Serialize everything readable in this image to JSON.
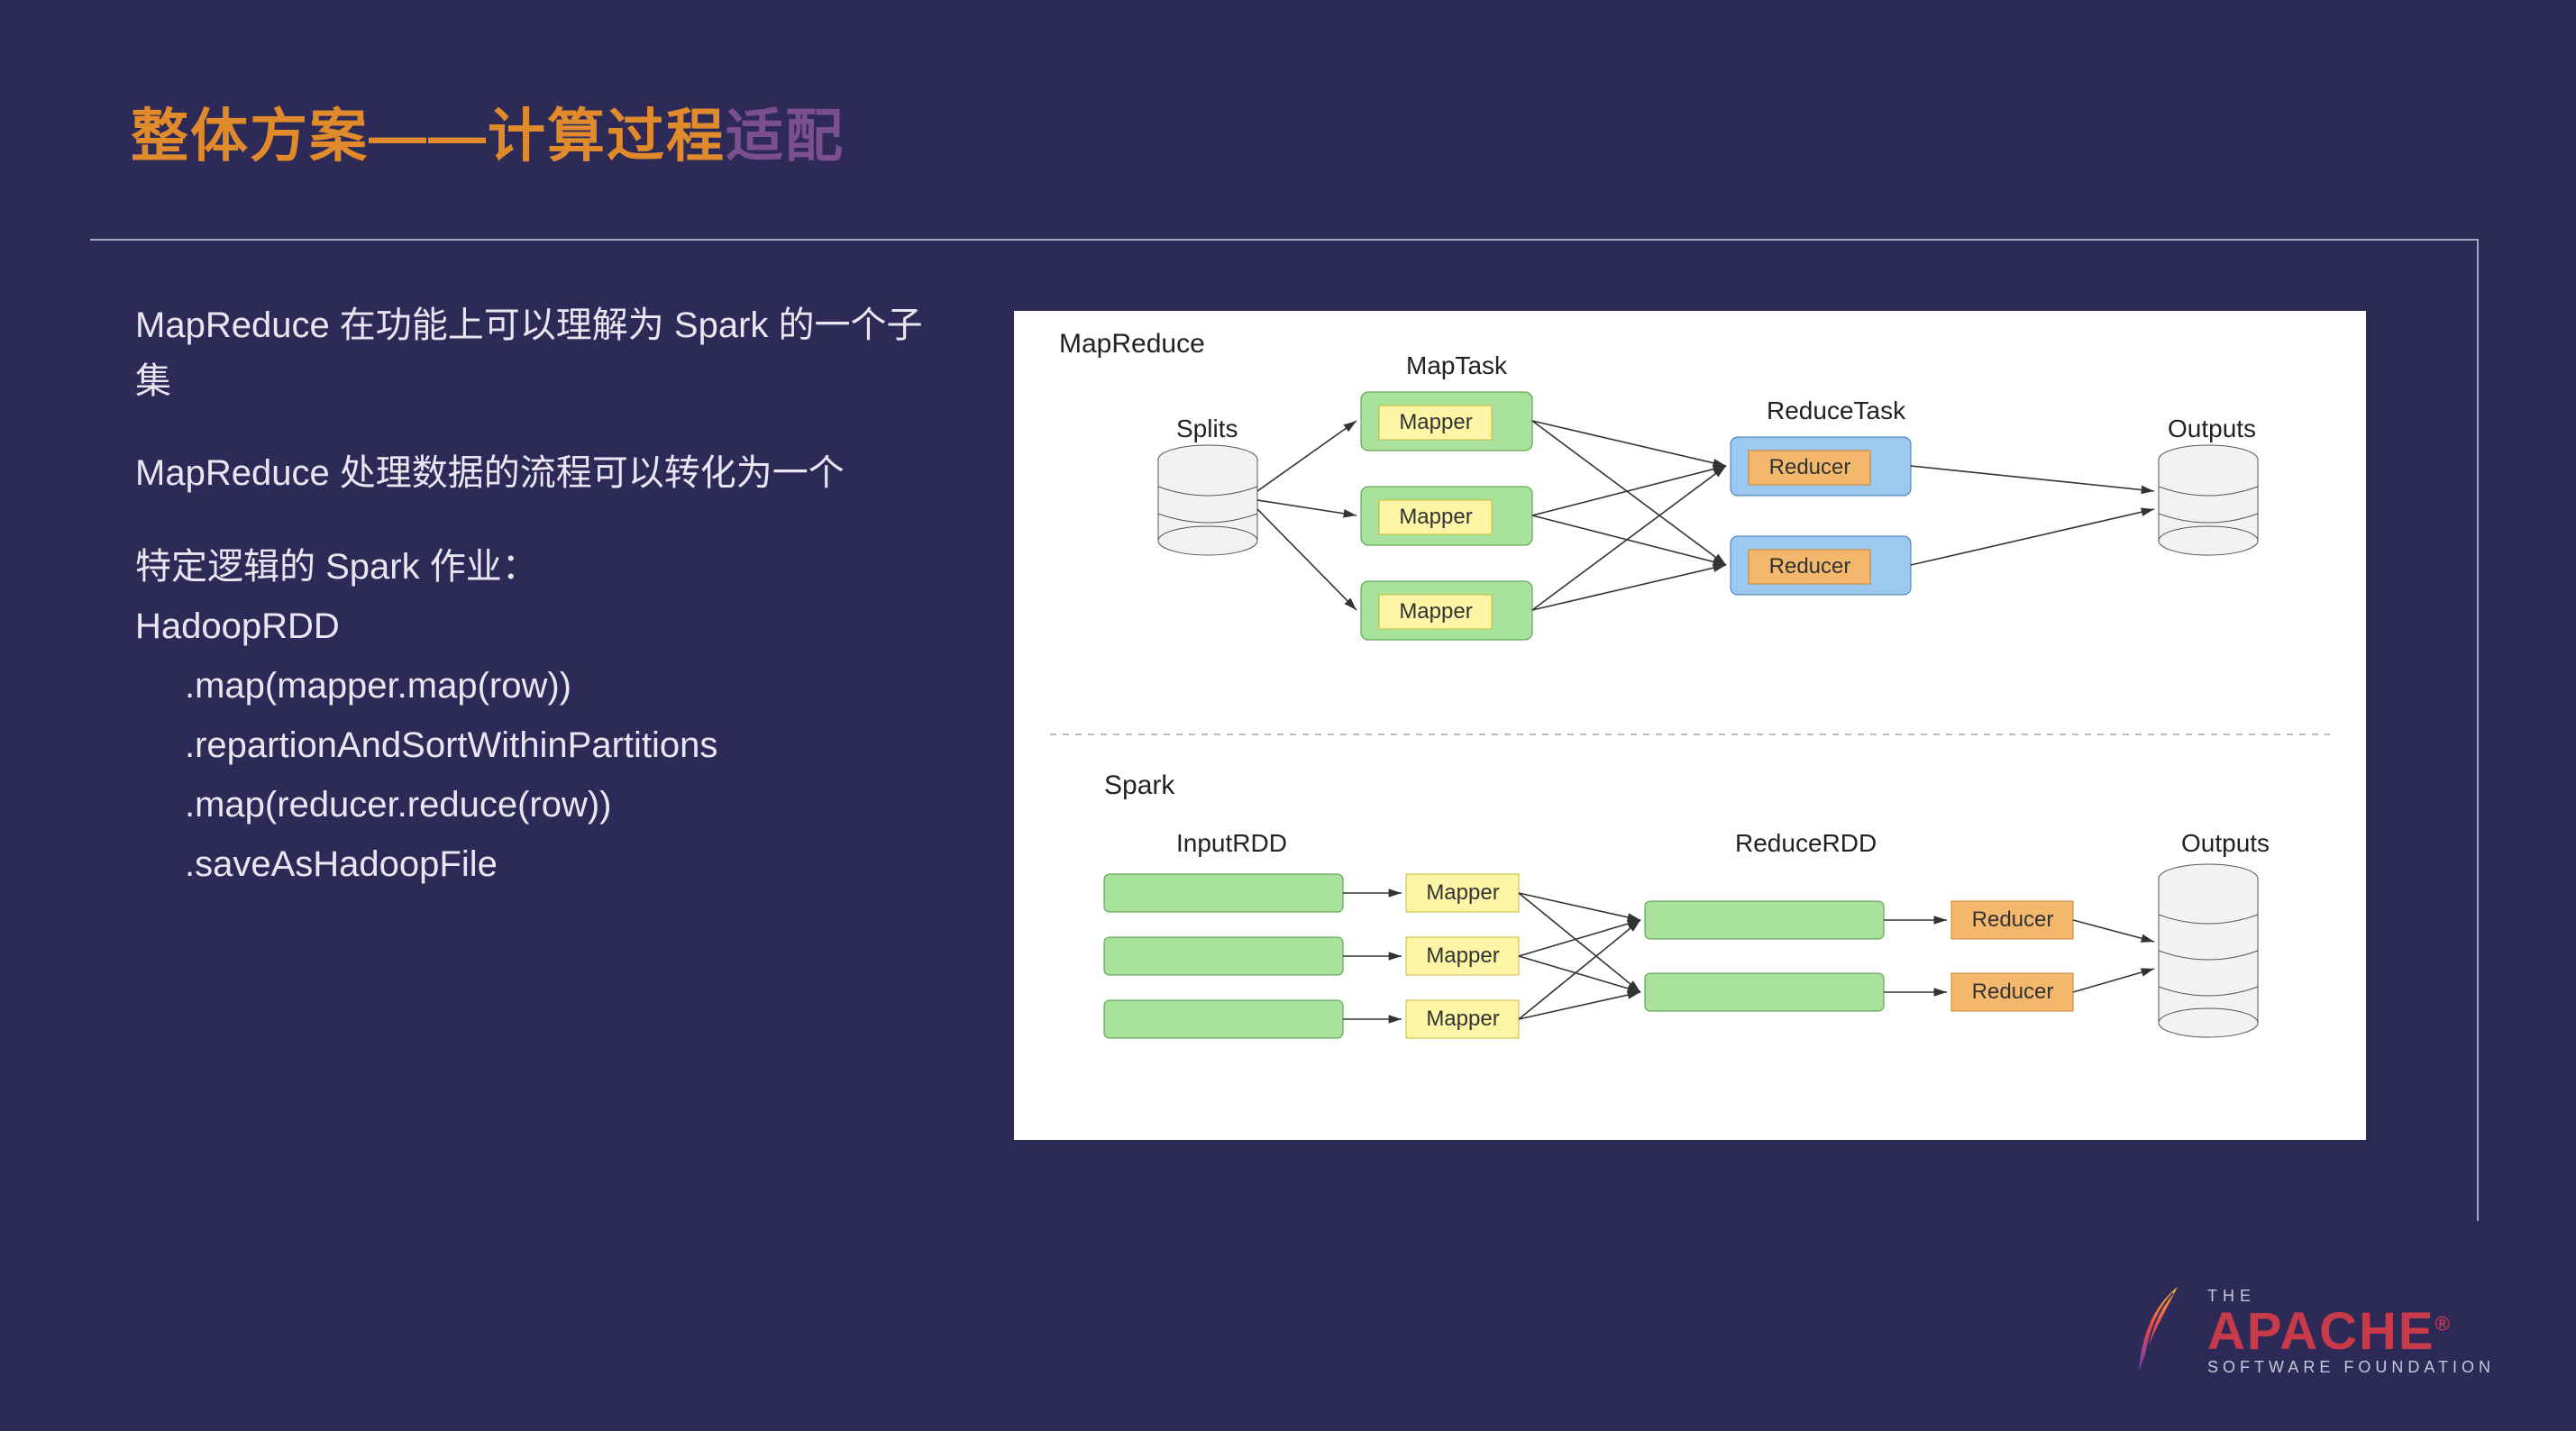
{
  "title": {
    "part1": "整体方案——计算",
    "part2": "过程",
    "part3": "适配"
  },
  "text": {
    "p1": "MapReduce 在功能上可以理解为 Spark 的一个子集",
    "p2": "MapReduce 处理数据的流程可以转化为一个",
    "p3": "特定逻辑的 Spark 作业：",
    "code": {
      "l1": "HadoopRDD",
      "l2": ".map(mapper.map(row))",
      "l3": ".repartionAndSortWithinPartitions",
      "l4": ".map(reducer.reduce(row))",
      "l5": ".saveAsHadoopFile"
    }
  },
  "diagram": {
    "mr": {
      "title": "MapReduce",
      "splits": "Splits",
      "maptask": "MapTask",
      "mapper": "Mapper",
      "reducetask": "ReduceTask",
      "reducer": "Reducer",
      "outputs": "Outputs"
    },
    "spark": {
      "title": "Spark",
      "inputrdd": "InputRDD",
      "mapper": "Mapper",
      "reducerdd": "ReduceRDD",
      "reducer": "Reducer",
      "outputs": "Outputs"
    }
  },
  "logo": {
    "the": "THE",
    "apache": "APACHE",
    "sf": "SOFTWARE FOUNDATION"
  }
}
